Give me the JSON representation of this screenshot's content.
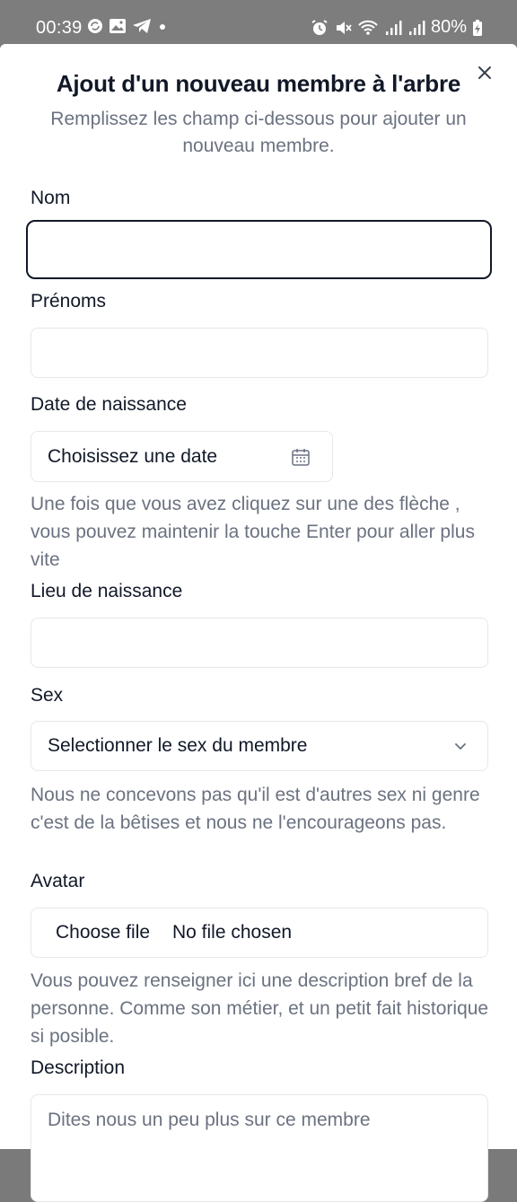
{
  "status_bar": {
    "time": "00:39",
    "battery": "80%",
    "left_icons": [
      "sync-icon",
      "image-icon",
      "telegram-icon",
      "dot-icon"
    ],
    "right_icons": [
      "alarm-icon",
      "mute-icon",
      "wifi-icon",
      "signal-icon",
      "signal-icon",
      "battery-charging-icon"
    ]
  },
  "dialog": {
    "title": "Ajout d'un nouveau membre à l'arbre",
    "subtitle": "Remplissez les champ ci-dessous pour ajouter un nouveau membre.",
    "close_icon": "close-icon"
  },
  "form": {
    "nom": {
      "label": "Nom",
      "value": ""
    },
    "prenoms": {
      "label": "Prénoms",
      "value": ""
    },
    "date_naissance": {
      "label": "Date de naissance",
      "value": "Choisissez une date",
      "help": "Une fois que vous avez cliquez sur une des flèche , vous pouvez maintenir la touche Enter pour aller plus vite"
    },
    "lieu_naissance": {
      "label": "Lieu de naissance",
      "value": ""
    },
    "sex": {
      "label": "Sex",
      "selected": "Selectionner le sex du membre",
      "help": "Nous ne concevons pas qu'il est d'autres sex ni genre c'est de la bêtises et nous ne l'encourageons pas."
    },
    "avatar": {
      "label": "Avatar",
      "button": "Choose file",
      "status": "No file chosen",
      "help": "Vous pouvez renseigner ici une description bref de la personne. Comme son métier, et un petit fait historique si posible."
    },
    "description": {
      "label": "Description",
      "placeholder": "Dites nous un peu plus sur ce membre"
    }
  },
  "colors": {
    "text": "#111827",
    "muted": "#6b7280",
    "border": "#e5e7eb",
    "status_bar": "#7d7d7d"
  }
}
